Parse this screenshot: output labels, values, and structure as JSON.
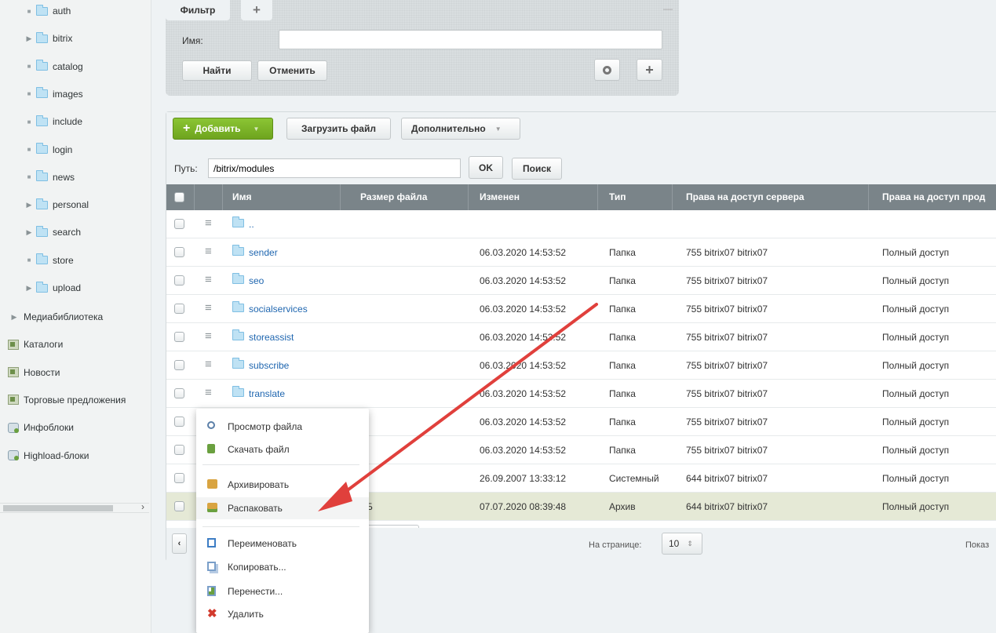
{
  "sidebar": {
    "folders": [
      {
        "label": "auth",
        "expandable": false
      },
      {
        "label": "bitrix",
        "expandable": true
      },
      {
        "label": "catalog",
        "expandable": false
      },
      {
        "label": "images",
        "expandable": false
      },
      {
        "label": "include",
        "expandable": false
      },
      {
        "label": "login",
        "expandable": false
      },
      {
        "label": "news",
        "expandable": false
      },
      {
        "label": "personal",
        "expandable": true
      },
      {
        "label": "search",
        "expandable": true
      },
      {
        "label": "store",
        "expandable": false
      },
      {
        "label": "upload",
        "expandable": true
      }
    ],
    "sections": [
      {
        "label": "Медиабиблиотека",
        "icon": "arrow"
      },
      {
        "label": "Каталоги",
        "icon": "catalog-icon"
      },
      {
        "label": "Новости",
        "icon": "catalog-icon"
      },
      {
        "label": "Торговые предложения",
        "icon": "catalog-icon"
      },
      {
        "label": "Инфоблоки",
        "icon": "iblock-icon"
      },
      {
        "label": "Highload-блоки",
        "icon": "iblock-icon"
      }
    ],
    "scroll_arrow": "›"
  },
  "filter": {
    "tab_label": "Фильтр",
    "add_tab": "+",
    "name_label": "Имя:",
    "name_value": "",
    "find_button": "Найти",
    "cancel_button": "Отменить",
    "minimize": "—"
  },
  "toolbar": {
    "add_button": "Добавить",
    "upload_button": "Загрузить файл",
    "more_button": "Дополнительно"
  },
  "path": {
    "label": "Путь:",
    "value": "/bitrix/modules",
    "ok_button": "OK",
    "search_button": "Поиск"
  },
  "table": {
    "headers": [
      "Имя",
      "Размер файла",
      "Изменен",
      "Тип",
      "Права на доступ сервера",
      "Права на доступ прод"
    ],
    "up_label": "..",
    "rows": [
      {
        "name": "sender",
        "size": "",
        "modified": "06.03.2020 14:53:52",
        "type": "Папка",
        "server_rights": "755 bitrix07 bitrix07",
        "rights": "Полный доступ"
      },
      {
        "name": "seo",
        "size": "",
        "modified": "06.03.2020 14:53:52",
        "type": "Папка",
        "server_rights": "755 bitrix07 bitrix07",
        "rights": "Полный доступ"
      },
      {
        "name": "socialservices",
        "size": "",
        "modified": "06.03.2020 14:53:52",
        "type": "Папка",
        "server_rights": "755 bitrix07 bitrix07",
        "rights": "Полный доступ"
      },
      {
        "name": "storeassist",
        "size": "",
        "modified": "06.03.2020 14:53:52",
        "type": "Папка",
        "server_rights": "755 bitrix07 bitrix07",
        "rights": "Полный доступ"
      },
      {
        "name": "subscribe",
        "size": "",
        "modified": "06.03.2020 14:53:52",
        "type": "Папка",
        "server_rights": "755 bitrix07 bitrix07",
        "rights": "Полный доступ"
      },
      {
        "name": "translate",
        "size": "",
        "modified": "06.03.2020 14:53:52",
        "type": "Папка",
        "server_rights": "755 bitrix07 bitrix07",
        "rights": "Полный доступ"
      },
      {
        "name": "",
        "size": "",
        "modified": "06.03.2020 14:53:52",
        "type": "Папка",
        "server_rights": "755 bitrix07 bitrix07",
        "rights": "Полный доступ"
      },
      {
        "name": "",
        "size": "",
        "modified": "06.03.2020 14:53:52",
        "type": "Папка",
        "server_rights": "755 bitrix07 bitrix07",
        "rights": "Полный доступ"
      },
      {
        "name": "",
        "size": "›",
        "modified": "26.09.2007 13:33:12",
        "type": "Системный",
        "server_rights": "644 bitrix07 bitrix07",
        "rights": "Полный доступ"
      },
      {
        "name": "",
        "size": "1 КБ",
        "modified": "07.07.2020 08:39:48",
        "type": "Архив",
        "server_rights": "644 bitrix07 bitrix07",
        "rights": "Полный доступ"
      }
    ]
  },
  "context_menu": {
    "items": [
      {
        "label": "Просмотр файла",
        "icon": "view-icon"
      },
      {
        "label": "Скачать файл",
        "icon": "download-icon"
      },
      {
        "label": "Архивировать",
        "icon": "archive-icon"
      },
      {
        "label": "Распаковать",
        "icon": "unpack-icon"
      },
      {
        "label": "Переименовать",
        "icon": "rename-icon"
      },
      {
        "label": "Копировать...",
        "icon": "copy-icon"
      },
      {
        "label": "Перенести...",
        "icon": "move-icon"
      },
      {
        "label": "Удалить",
        "icon": "delete-icon"
      }
    ]
  },
  "pager": {
    "per_page_label": "На странице:",
    "per_page_value": "10",
    "show_label": "Показ"
  },
  "colors": {
    "accent_green": "#7bb321",
    "annotation_arrow": "#e0403c",
    "row_highlight": "#e5e9d6"
  }
}
